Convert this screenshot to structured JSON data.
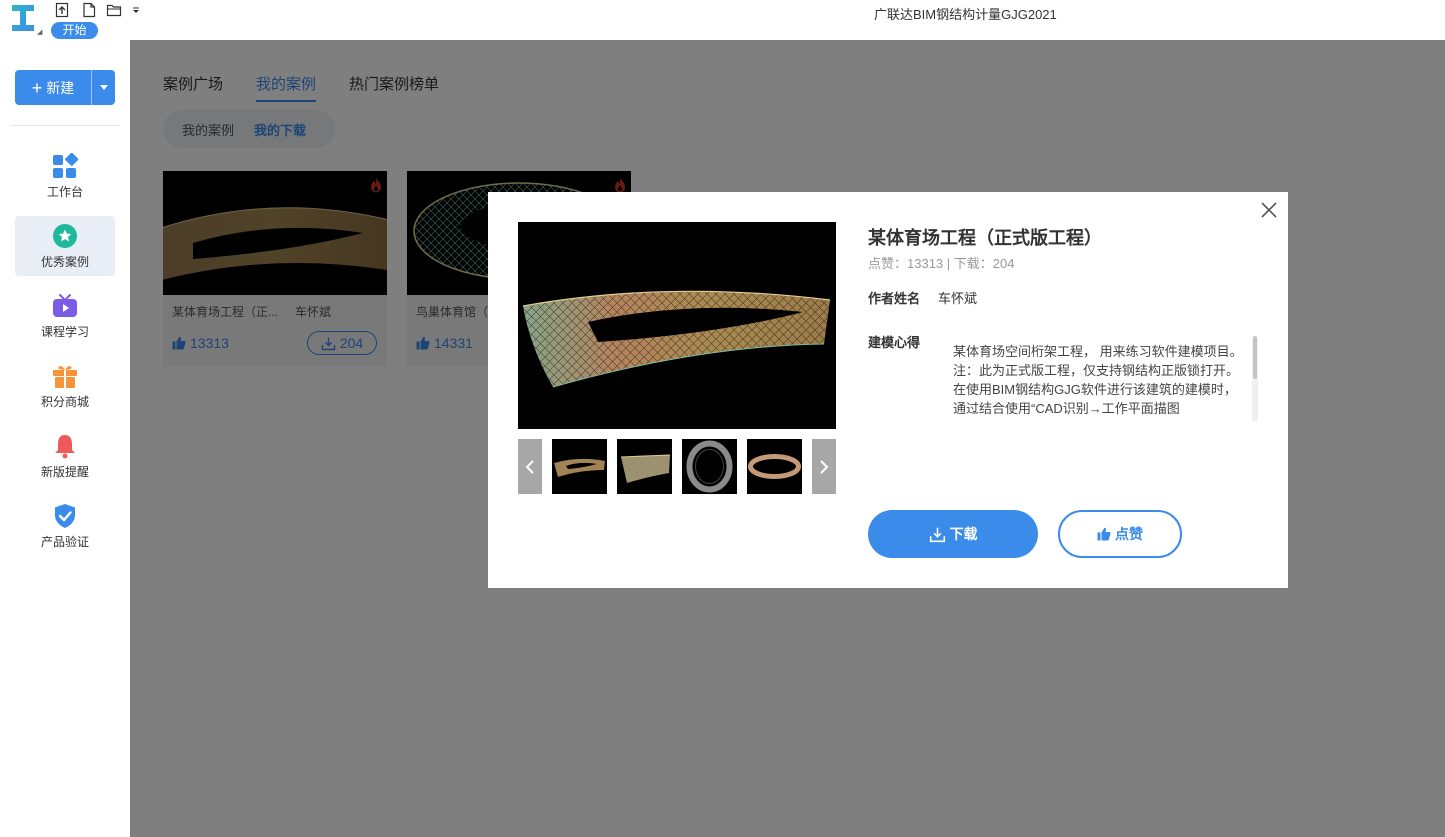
{
  "titlebar": {
    "app_title": "广联达BIM钢结构计量GJG2021",
    "start_label": "开始",
    "quick_icons": [
      "import-icon",
      "new-file-icon",
      "open-folder-icon",
      "customize-caret-icon"
    ]
  },
  "sidebar": {
    "new_label": "新建",
    "items": [
      {
        "label": "工作台",
        "icon": "grid-icon",
        "color": "#3b8bea"
      },
      {
        "label": "优秀案例",
        "icon": "star-badge-icon",
        "color": "#1fb89a"
      },
      {
        "label": "课程学习",
        "icon": "tv-icon",
        "color": "#7b5ce6"
      },
      {
        "label": "积分商城",
        "icon": "gift-icon",
        "color": "#f5943a"
      },
      {
        "label": "新版提醒",
        "icon": "bell-icon",
        "color": "#ee5a5a"
      },
      {
        "label": "产品验证",
        "icon": "shield-check-icon",
        "color": "#3b8bea"
      }
    ]
  },
  "content": {
    "tabs": [
      "案例广场",
      "我的案例",
      "热门案例榜单"
    ],
    "active_tab": "我的案例",
    "subtabs": [
      "我的案例",
      "我的下载"
    ],
    "active_subtab": "我的下载",
    "cards": [
      {
        "name": "某体育场工程（正...",
        "author": "车怀斌",
        "likes": "13313",
        "downloads": "204"
      },
      {
        "name": "鸟巢体育馆（",
        "likes": "14331"
      }
    ]
  },
  "modal": {
    "title": "某体育场工程（正式版工程）",
    "stats": "点赞：13313  |  下载：204",
    "author_label": "作者姓名",
    "author": "车怀斌",
    "notes_label": "建模心得",
    "notes": [
      "某体育场空间桁架工程， 用来练习软件建模项目。注：此为正式版工程，仅支持钢结构正版锁打开。",
      "在使用BIM钢结构GJG软件进行该建筑的建模时，通过结合使用“CAD识别→工作平面描图"
    ],
    "download_label": "下载",
    "like_label": "点赞"
  },
  "colors": {
    "accent": "#3b8bea",
    "overlay": "rgba(0,0,0,0.5)"
  }
}
